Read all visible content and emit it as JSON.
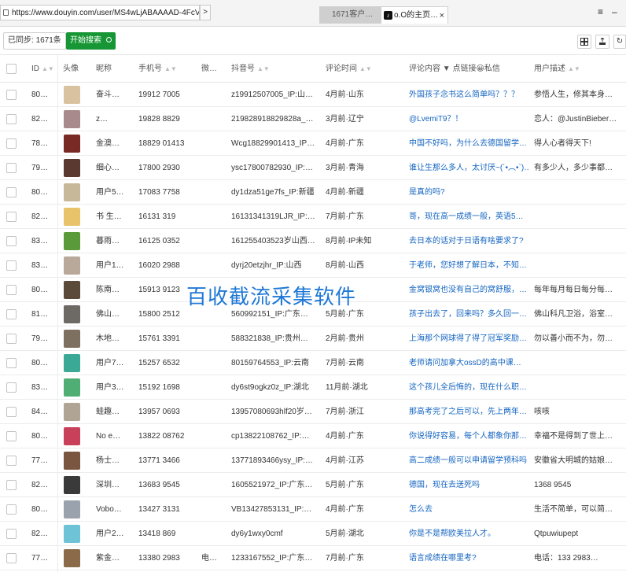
{
  "browser": {
    "url": "https://www.douyin.com/user/MS4wLjABAAAAD-4FcVNgdvrvTfvKO",
    "nav_arrow": ">",
    "tabs": [
      {
        "label": "1671客户…"
      },
      {
        "label": "o.O的主页…",
        "close": "×"
      }
    ],
    "controls": [
      "≡",
      "–"
    ]
  },
  "toolbar": {
    "synced_label": "已同步:",
    "synced_count": "1671条",
    "start_label": "开始搜索",
    "icons": [
      "grid-icon",
      "export-icon",
      "refresh-icon"
    ]
  },
  "table": {
    "columns": {
      "id": "ID",
      "avatar": "头像",
      "nickname": "昵称",
      "phone": "手机号",
      "wechat": "微…",
      "douyin": "抖音号",
      "time": "评论时间",
      "comment": "评论内容 ▼ 点链接😀私信",
      "desc": "用户描述"
    },
    "rows": [
      {
        "id": "80…",
        "avatar_color": "#d8c2a0",
        "name": "奋斗…",
        "phone": "19912 7005",
        "wx": "",
        "dy": "z19912507005_IP:山…",
        "time": "4月前·山东",
        "comment": "外国孩子念书这么简单吗？？？",
        "desc": "参悟人生，修其本身…"
      },
      {
        "id": "82…",
        "avatar_color": "#a98a8c",
        "name": "z…",
        "phone": "19828 8829",
        "wx": "",
        "dy": "219828918829828a_…",
        "time": "3月前·辽宁",
        "comment": "@LvemiT9？！",
        "desc": "恋人：@JustinBieber…"
      },
      {
        "id": "78…",
        "avatar_color": "#7a2a24",
        "name": "金澳…",
        "phone": "18829 01413",
        "wx": "",
        "dy": "Wcg18829901413_IP…",
        "time": "4月前·广东",
        "comment": "中国不好吗，为什么去德国留学…",
        "desc": "得人心者得天下!"
      },
      {
        "id": "79…",
        "avatar_color": "#5a3a30",
        "name": "细心…",
        "phone": "17800 2930",
        "wx": "",
        "dy": "ysc17800782930_IP:…",
        "time": "3月前·青海",
        "comment": "谁让生那么多人，太讨厌~(´•︵•`)…",
        "desc": "有多少人，多少事都…"
      },
      {
        "id": "80…",
        "avatar_color": "#c7b89a",
        "name": "用户5…",
        "phone": "17083 7758",
        "wx": "",
        "dy": "dy1dza51ge7fs_IP:新疆",
        "time": "4月前·新疆",
        "comment": "是真的吗?",
        "desc": ""
      },
      {
        "id": "82…",
        "avatar_color": "#e8c36a",
        "name": "书 生…",
        "phone": "16131 319",
        "wx": "",
        "dy": "16131341319LJR_IP:…",
        "time": "7月前·广东",
        "comment": "哥，现在高一成绩一般，英语5…",
        "desc": ""
      },
      {
        "id": "83…",
        "avatar_color": "#5a9a3a",
        "name": "暮雨…",
        "phone": "16125 0352",
        "wx": "",
        "dy": "161255403523岁山西…",
        "time": "8月前·IP未知",
        "comment": "去日本的话对于日语有啥要求了?",
        "desc": ""
      },
      {
        "id": "83…",
        "avatar_color": "#b9a99a",
        "name": "用户1…",
        "phone": "16020 2988",
        "wx": "",
        "dy": "dyrj20etzjhr_IP:山西",
        "time": "8月前·山西",
        "comment": "于老师，您好想了解日本，不知…",
        "desc": ""
      },
      {
        "id": "80…",
        "avatar_color": "#5b4a3a",
        "name": "陈南…",
        "phone": "15913 9123",
        "wx": "",
        "dy": "",
        "time": "",
        "comment": "金窝银窝也没有自己的窝舒服，…",
        "desc": "每年每月每日每分每…"
      },
      {
        "id": "81…",
        "avatar_color": "#6d6a66",
        "name": "佛山…",
        "phone": "15800 2512",
        "wx": "",
        "dy": "560992151_IP:广东…",
        "time": "5月前·广东",
        "comment": "孩子出去了，回来吗？多久回一…",
        "desc": "佛山科凡卫浴，浴室…"
      },
      {
        "id": "79…",
        "avatar_color": "#7d7060",
        "name": "木地…",
        "phone": "15761 3391",
        "wx": "",
        "dy": "588321838_IP:贵州…",
        "time": "2月前·贵州",
        "comment": "上海那个网球得了得了冠军奖励…",
        "desc": "勿以善小而不为，勿…"
      },
      {
        "id": "80…",
        "avatar_color": "#3aaa96",
        "name": "用户7…",
        "phone": "15257 6532",
        "wx": "",
        "dy": "80159764553_IP:云南",
        "time": "7月前·云南",
        "comment": "老师请问加拿大ossD的高中课…",
        "desc": ""
      },
      {
        "id": "83…",
        "avatar_color": "#4fae74",
        "name": "用户3…",
        "phone": "15192 1698",
        "wx": "",
        "dy": "dy6st9ogkz0z_IP:湖北",
        "time": "11月前·湖北",
        "comment": "这个孩儿全后悔的，现在什么职…",
        "desc": ""
      },
      {
        "id": "84…",
        "avatar_color": "#b0a494",
        "name": "蛙趣…",
        "phone": "13957 0693",
        "wx": "",
        "dy": "13957080693hlf20岁…",
        "time": "7月前·浙江",
        "comment": "那高考完了之后可以，先上两年…",
        "desc": "咳咳"
      },
      {
        "id": "80…",
        "avatar_color": "#c8405a",
        "name": "No e…",
        "phone": "13822 08762",
        "wx": "",
        "dy": "cp13822108762_IP:…",
        "time": "4月前·广东",
        "comment": "你说得好容易，每个人都象你那…",
        "desc": "幸福不是得到了世上…"
      },
      {
        "id": "77…",
        "avatar_color": "#7a5540",
        "name": "杨士…",
        "phone": "13771 3466",
        "wx": "",
        "dy": "13771893466ysy_IP:…",
        "time": "4月前·江苏",
        "comment": "高二成绩一般可以申请留学预科吗",
        "desc": "安徽省大明城的姑娘…"
      },
      {
        "id": "82…",
        "avatar_color": "#3a3a3a",
        "name": "深圳…",
        "phone": "13683 9545",
        "wx": "",
        "dy": "1605521972_IP:广东…",
        "time": "5月前·广东",
        "comment": "德国，现在去送死吗",
        "desc": "1368 9545"
      },
      {
        "id": "80…",
        "avatar_color": "#9aa3ad",
        "name": "Vobo…",
        "phone": "13427 3131",
        "wx": "",
        "dy": "VB13427853131_IP:…",
        "time": "4月前·广东",
        "comment": "怎么去",
        "desc": "生活不简单，可以简…"
      },
      {
        "id": "82…",
        "avatar_color": "#6fc3d6",
        "name": "用户2…",
        "phone": "13418 869",
        "wx": "",
        "dy": "dy6y1wxy0cmf",
        "time": "5月前·湖北",
        "comment": "你是不是帮欧美拉人才。",
        "desc": "Qtpuwiupept"
      },
      {
        "id": "77…",
        "avatar_color": "#8a6a48",
        "name": "紫金…",
        "phone": "13380 2983",
        "wx": "电…",
        "dy": "1233167552_IP:广东…",
        "time": "7月前·广东",
        "comment": "语言成绩在哪里考?",
        "desc": "电话：133 2983…"
      }
    ]
  },
  "watermark": "百收截流采集软件",
  "colors": {
    "accent_green": "#169634",
    "comment_blue": "#1565c0",
    "watermark_blue": "#1e78d6"
  }
}
